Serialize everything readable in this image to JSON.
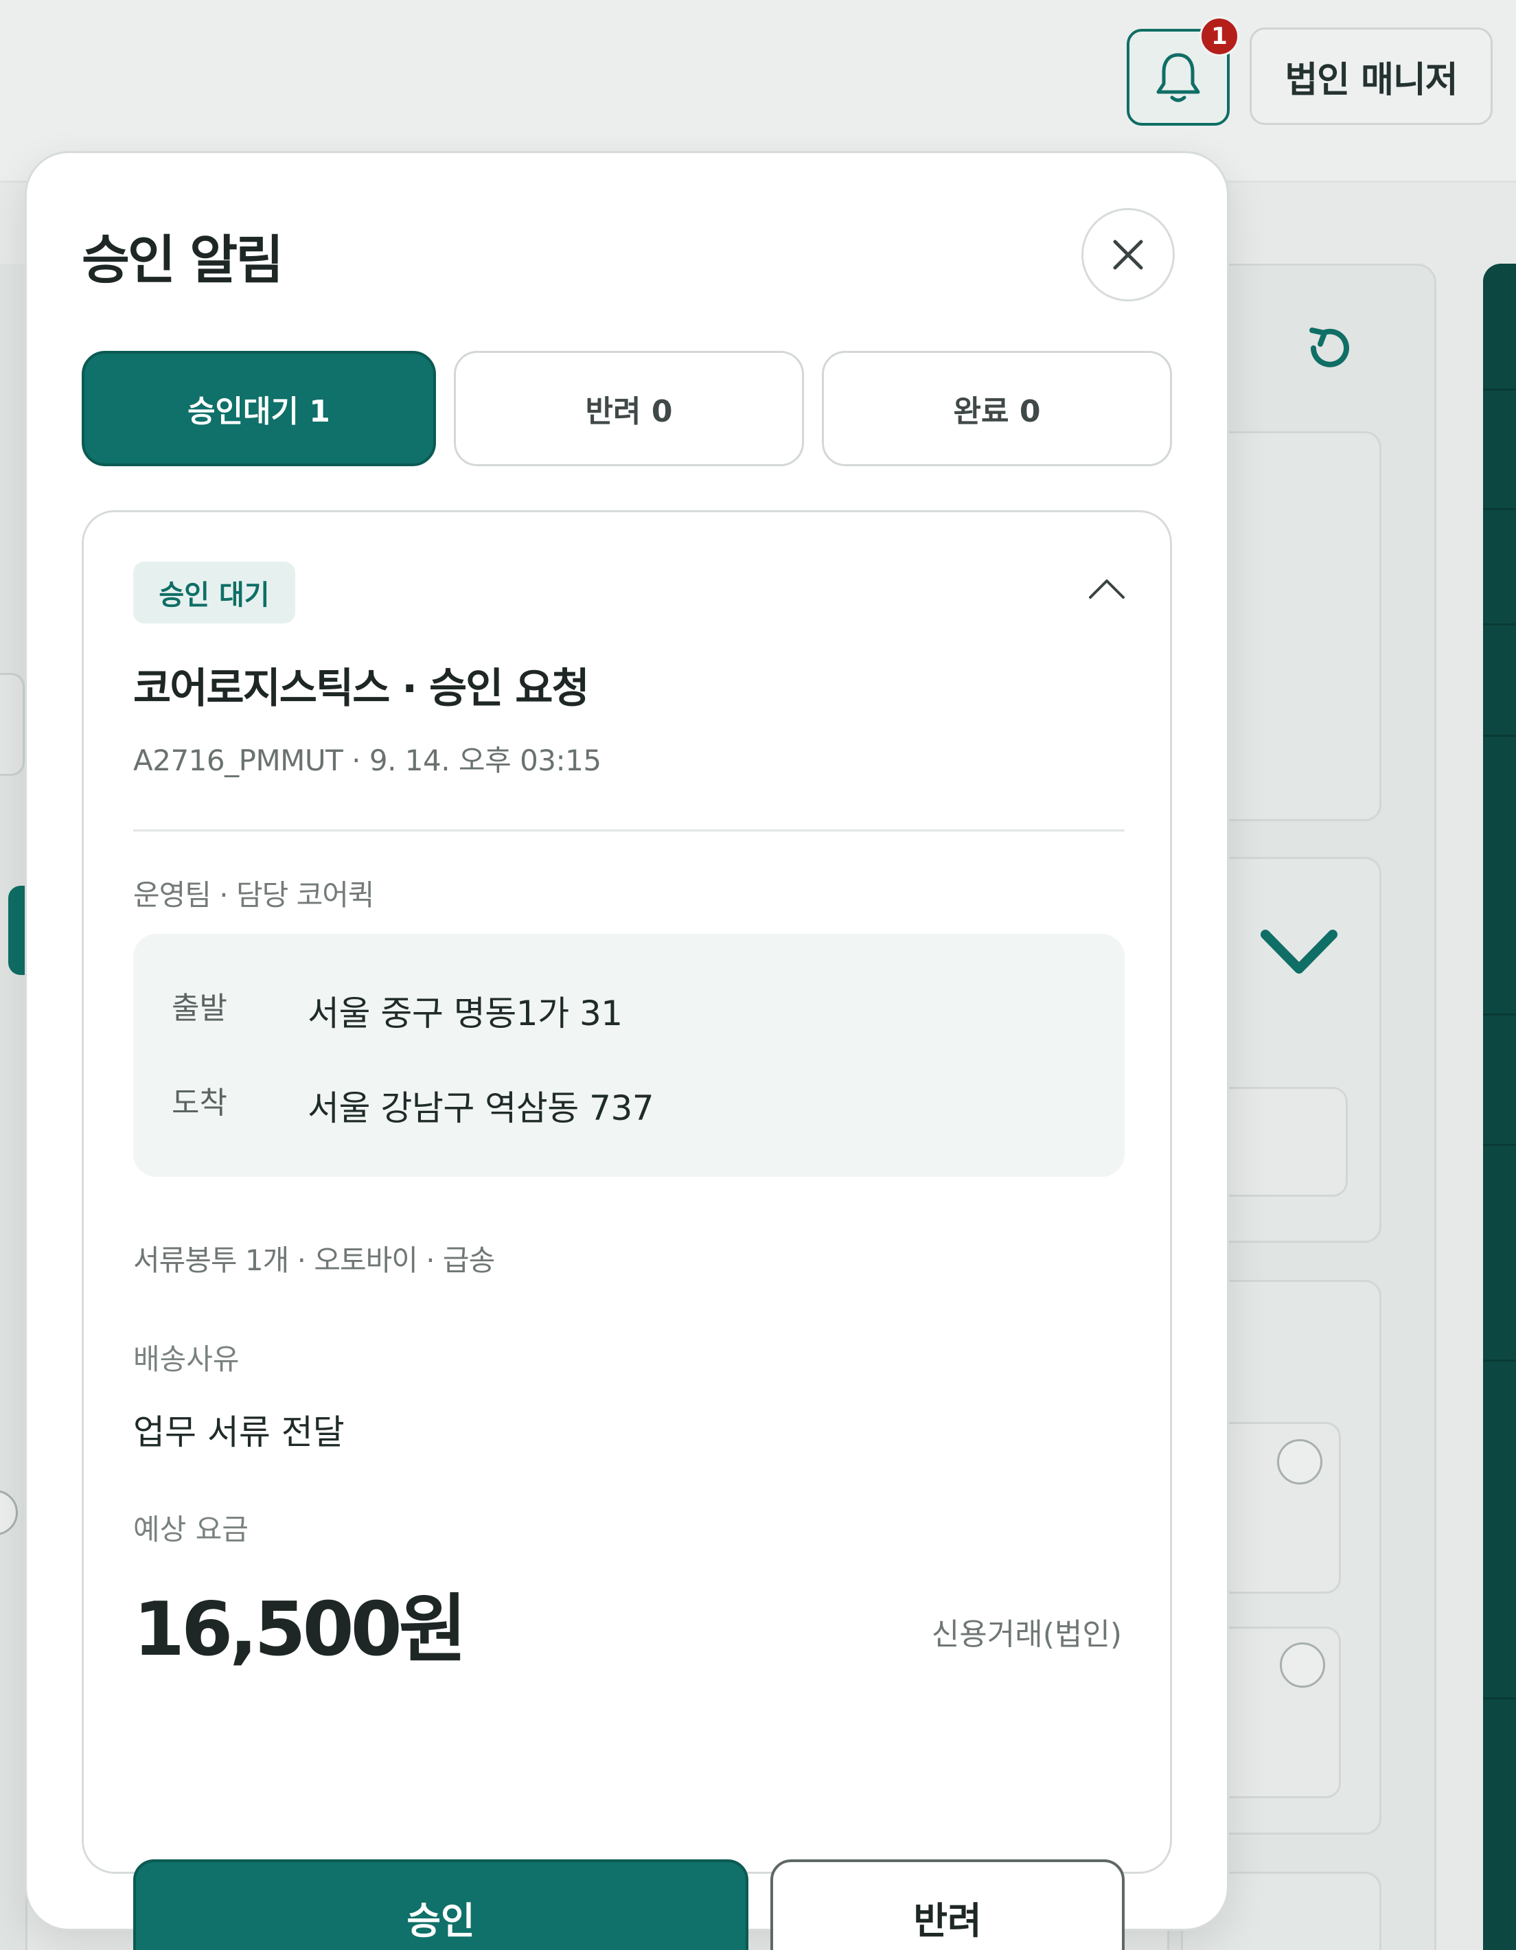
{
  "header": {
    "notification_count": "1",
    "account_label": "법인 매니저"
  },
  "modal": {
    "title": "승인 알림",
    "tabs": [
      {
        "label": "승인대기 1",
        "active": true
      },
      {
        "label": "반려 0",
        "active": false
      },
      {
        "label": "완료 0",
        "active": false
      }
    ],
    "request": {
      "status_badge": "승인 대기",
      "title": "코어로지스틱스 · 승인 요청",
      "meta": "A2716_PMMUT · 9. 14. 오후 03:15",
      "team": "운영팀 · 담당 코어퀵",
      "route": {
        "origin_label": "출발",
        "origin": "서울 중구 명동1가 31",
        "destination_label": "도착",
        "destination": "서울 강남구 역삼동 737"
      },
      "spec": "서류봉투 1개 · 오토바이 · 급송",
      "reason_label": "배송사유",
      "reason": "업무 서류 전달",
      "fare_label": "예상 요금",
      "fare": "16,500원",
      "payment_method": "신용거래(법인)",
      "approve_label": "승인",
      "reject_label": "반려"
    }
  },
  "colors": {
    "accent": "#0f7169",
    "badge_red": "#b51f1a",
    "background_dark": "#0d4741"
  },
  "icons": [
    "bell-icon",
    "close-icon",
    "chevron-up-icon",
    "refresh-icon",
    "chevron-down-icon"
  ]
}
